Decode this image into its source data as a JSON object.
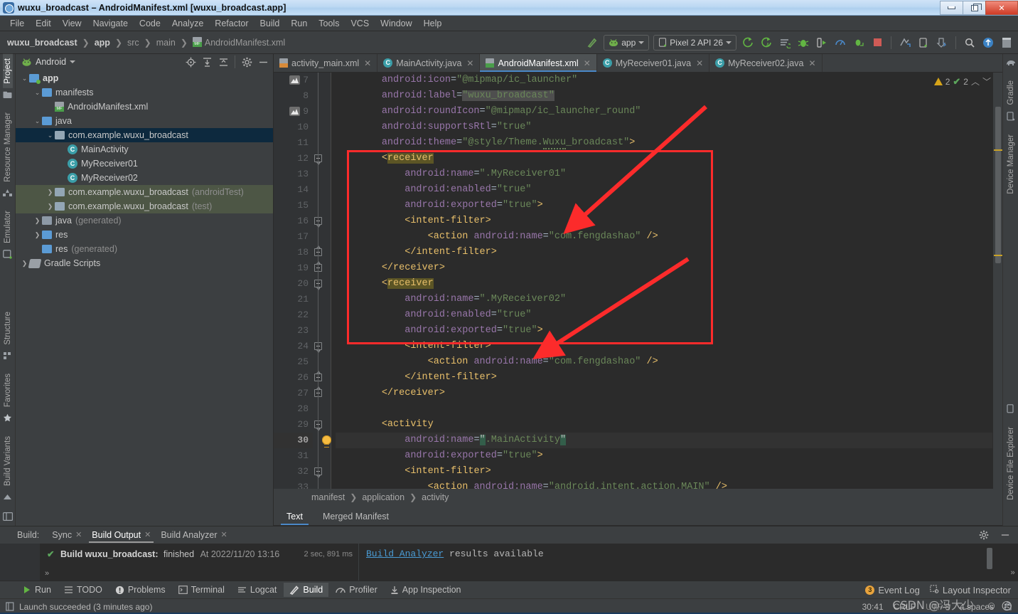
{
  "window": {
    "title": "wuxu_broadcast – AndroidManifest.xml [wuxu_broadcast.app]",
    "minimize_label": "Minimize",
    "maximize_label": "Restore",
    "close_label": "Close"
  },
  "menubar": [
    "File",
    "Edit",
    "View",
    "Navigate",
    "Code",
    "Analyze",
    "Refactor",
    "Build",
    "Run",
    "Tools",
    "VCS",
    "Window",
    "Help"
  ],
  "navbar": {
    "breadcrumbs": [
      {
        "label": "wuxu_broadcast",
        "bold": true,
        "icon": ""
      },
      {
        "label": "app",
        "bold": true,
        "icon": ""
      },
      {
        "label": "src",
        "bold": false,
        "icon": ""
      },
      {
        "label": "main",
        "bold": false,
        "icon": ""
      },
      {
        "label": "AndroidManifest.xml",
        "bold": false,
        "icon": "manifest-file-icon"
      }
    ],
    "run_config": "app",
    "device": "Pixel 2 API 26",
    "icons": [
      "build-hammer-icon",
      "run-icon",
      "rerun-icon",
      "apply-changes-icon",
      "debug-icon",
      "run-to-cursor-icon",
      "profiler-icon",
      "attach-debugger-icon",
      "stop-icon",
      "avd-manager-icon",
      "sdk-manager-icon",
      "sync-gradle-icon",
      "search-icon",
      "account-icon",
      "layout-icon"
    ]
  },
  "left_strip": [
    "Project",
    "Resource Manager",
    "Emulator",
    "Structure",
    "Favorites",
    "Build Variants"
  ],
  "right_strip": [
    "Gradle",
    "Device Manager",
    "Device File Explorer"
  ],
  "project_panel": {
    "title": "Android",
    "toolbar_icons": [
      "select-opened-file-icon",
      "expand-all-icon",
      "collapse-all-icon",
      "settings-gear-icon",
      "hide-icon"
    ],
    "tree": [
      {
        "depth": 0,
        "arrow": "v",
        "icon": "folder-app",
        "label": "app",
        "bold": true,
        "suffix": "",
        "state": "normal"
      },
      {
        "depth": 1,
        "arrow": "v",
        "icon": "folder",
        "label": "manifests",
        "bold": false,
        "suffix": "",
        "state": "normal"
      },
      {
        "depth": 2,
        "arrow": "",
        "icon": "manifest-file-icon",
        "label": "AndroidManifest.xml",
        "bold": false,
        "suffix": "",
        "state": "normal"
      },
      {
        "depth": 1,
        "arrow": "v",
        "icon": "folder",
        "label": "java",
        "bold": false,
        "suffix": "",
        "state": "normal"
      },
      {
        "depth": 2,
        "arrow": "v",
        "icon": "folder-pkg",
        "label": "com.example.wuxu_broadcast",
        "bold": false,
        "suffix": "",
        "state": "selected"
      },
      {
        "depth": 3,
        "arrow": "",
        "icon": "class-icon",
        "label": "MainActivity",
        "bold": false,
        "suffix": "",
        "state": "normal"
      },
      {
        "depth": 3,
        "arrow": "",
        "icon": "class-icon",
        "label": "MyReceiver01",
        "bold": false,
        "suffix": "",
        "state": "normal"
      },
      {
        "depth": 3,
        "arrow": "",
        "icon": "class-icon",
        "label": "MyReceiver02",
        "bold": false,
        "suffix": "",
        "state": "normal"
      },
      {
        "depth": 2,
        "arrow": ">",
        "icon": "folder-pkg",
        "label": "com.example.wuxu_broadcast",
        "bold": false,
        "suffix": "(androidTest)",
        "state": "test"
      },
      {
        "depth": 2,
        "arrow": ">",
        "icon": "folder-pkg",
        "label": "com.example.wuxu_broadcast",
        "bold": false,
        "suffix": "(test)",
        "state": "test"
      },
      {
        "depth": 1,
        "arrow": ">",
        "icon": "folder-gen",
        "label": "java",
        "bold": false,
        "suffix": "(generated)",
        "state": "normal"
      },
      {
        "depth": 1,
        "arrow": ">",
        "icon": "folder-res",
        "label": "res",
        "bold": false,
        "suffix": "",
        "state": "normal"
      },
      {
        "depth": 1,
        "arrow": "",
        "icon": "folder-res",
        "label": "res",
        "bold": false,
        "suffix": "(generated)",
        "state": "normal"
      },
      {
        "depth": 0,
        "arrow": ">",
        "icon": "gradle-icon",
        "label": "Gradle Scripts",
        "bold": false,
        "suffix": "",
        "state": "normal"
      }
    ]
  },
  "editor": {
    "tabs": [
      {
        "label": "activity_main.xml",
        "icon": "xml-layout-icon",
        "active": false
      },
      {
        "label": "MainActivity.java",
        "icon": "java-class-icon",
        "active": false
      },
      {
        "label": "AndroidManifest.xml",
        "icon": "manifest-file-icon",
        "active": true
      },
      {
        "label": "MyReceiver01.java",
        "icon": "java-class-icon",
        "active": false
      },
      {
        "label": "MyReceiver02.java",
        "icon": "java-class-icon",
        "active": false
      }
    ],
    "inspection": {
      "warnings": "2",
      "checks": "2"
    },
    "first_line": 7,
    "current_line": 30,
    "lines": [
      {
        "n": 7,
        "gutter_icon": "image-preview-icon",
        "fold": "",
        "html": "        <span class='attr'>android:icon</span><span class='eq'>=</span><span class='val'>\"@mipmap/ic_launcher\"</span>"
      },
      {
        "n": 8,
        "gutter_icon": "",
        "fold": "",
        "html": "        <span class='attr'>android:label</span><span class='eq'>=</span><span class='val hl'>\"wuxu_broadcast\"</span>"
      },
      {
        "n": 9,
        "gutter_icon": "image-preview-icon",
        "fold": "",
        "html": "        <span class='attr'>android:roundIcon</span><span class='eq'>=</span><span class='val'>\"@mipmap/ic_launcher_round\"</span>"
      },
      {
        "n": 10,
        "gutter_icon": "",
        "fold": "",
        "html": "        <span class='attr'>android:supportsRtl</span><span class='eq'>=</span><span class='val'>\"true\"</span>"
      },
      {
        "n": 11,
        "gutter_icon": "",
        "fold": "",
        "html": "        <span class='attr'>android:theme</span><span class='eq'>=</span><span class='val'>\"@style/Theme.<span class='wavy'>Wuxu</span>_broadcast\"</span><span class='tagp'>></span>"
      },
      {
        "n": 12,
        "gutter_icon": "",
        "fold": "down",
        "html": "        <span class='tagp'>&lt;</span><span class='tag hl'>receiver</span>"
      },
      {
        "n": 13,
        "gutter_icon": "",
        "fold": "",
        "html": "            <span class='attr'>android:name</span><span class='eq'>=</span><span class='val'>\".MyReceiver01\"</span>"
      },
      {
        "n": 14,
        "gutter_icon": "",
        "fold": "",
        "html": "            <span class='attr'>android:enabled</span><span class='eq'>=</span><span class='val'>\"true\"</span>"
      },
      {
        "n": 15,
        "gutter_icon": "",
        "fold": "",
        "html": "            <span class='attr'>android:exported</span><span class='eq'>=</span><span class='val'>\"true\"</span><span class='tagp'>></span>"
      },
      {
        "n": 16,
        "gutter_icon": "",
        "fold": "down",
        "html": "            <span class='tagp'>&lt;</span><span class='tag'>intent-filter</span><span class='tagp'>></span>"
      },
      {
        "n": 17,
        "gutter_icon": "",
        "fold": "",
        "html": "                <span class='tagp'>&lt;</span><span class='tag'>action</span> <span class='attr'>android:name</span><span class='eq'>=</span><span class='val'>\"com.fengdashao\"</span> <span class='tagp'>/></span>"
      },
      {
        "n": 18,
        "gutter_icon": "",
        "fold": "up",
        "html": "            <span class='tagp'>&lt;/</span><span class='tag'>intent-filter</span><span class='tagp'>></span>"
      },
      {
        "n": 19,
        "gutter_icon": "",
        "fold": "up",
        "html": "        <span class='tagp'>&lt;/</span><span class='tag'>receiver</span><span class='tagp'>></span>"
      },
      {
        "n": 20,
        "gutter_icon": "",
        "fold": "down",
        "html": "        <span class='tagp'>&lt;</span><span class='tag hl'>receiver</span>"
      },
      {
        "n": 21,
        "gutter_icon": "",
        "fold": "",
        "html": "            <span class='attr'>android:name</span><span class='eq'>=</span><span class='val'>\".MyReceiver02\"</span>"
      },
      {
        "n": 22,
        "gutter_icon": "",
        "fold": "",
        "html": "            <span class='attr'>android:enabled</span><span class='eq'>=</span><span class='val'>\"true\"</span>"
      },
      {
        "n": 23,
        "gutter_icon": "",
        "fold": "",
        "html": "            <span class='attr'>android:exported</span><span class='eq'>=</span><span class='val'>\"true\"</span><span class='tagp'>></span>"
      },
      {
        "n": 24,
        "gutter_icon": "",
        "fold": "down",
        "html": "            <span class='tagp'>&lt;</span><span class='tag'>intent-filter</span><span class='tagp'>></span>"
      },
      {
        "n": 25,
        "gutter_icon": "",
        "fold": "",
        "html": "                <span class='tagp'>&lt;</span><span class='tag'>action</span> <span class='attr'>android:name</span><span class='eq'>=</span><span class='val'>\"com.fengdashao\"</span> <span class='tagp'>/></span>"
      },
      {
        "n": 26,
        "gutter_icon": "",
        "fold": "up",
        "html": "            <span class='tagp'>&lt;/</span><span class='tag'>intent-filter</span><span class='tagp'>></span>"
      },
      {
        "n": 27,
        "gutter_icon": "",
        "fold": "up",
        "html": "        <span class='tagp'>&lt;/</span><span class='tag'>receiver</span><span class='tagp'>></span>"
      },
      {
        "n": 28,
        "gutter_icon": "",
        "fold": "",
        "html": ""
      },
      {
        "n": 29,
        "gutter_icon": "",
        "fold": "down",
        "html": "        <span class='tagp'>&lt;</span><span class='tag'>activity</span>"
      },
      {
        "n": 30,
        "gutter_icon": "intention-bulb-icon",
        "fold": "",
        "html": "            <span class='attr'>android:name</span><span class='eq'>=</span><span class='valsel'>\"</span><span class='val'>.MainActivity</span><span class='valsel'>\"</span>"
      },
      {
        "n": 31,
        "gutter_icon": "",
        "fold": "",
        "html": "            <span class='attr'>android:exported</span><span class='eq'>=</span><span class='val'>\"true\"</span><span class='tagp'>></span>"
      },
      {
        "n": 32,
        "gutter_icon": "",
        "fold": "down",
        "html": "            <span class='tagp'>&lt;</span><span class='tag'>intent-filter</span><span class='tagp'>></span>"
      },
      {
        "n": 33,
        "gutter_icon": "",
        "fold": "",
        "html": "                <span class='tagp'>&lt;</span><span class='tag'>action</span> <span class='attr'>android:name</span><span class='eq'>=</span><span class='val'>\"android.intent.action.MAIN\"</span> <span class='tagp'>/></span>"
      }
    ],
    "breadcrumbs": [
      "manifest",
      "application",
      "activity"
    ],
    "view_tabs": [
      {
        "label": "Text",
        "active": true
      },
      {
        "label": "Merged Manifest",
        "active": false
      }
    ]
  },
  "annotations": {
    "box_color": "#fc2b2b",
    "arrow_color": "#fc2b2b"
  },
  "build_window": {
    "label": "Build:",
    "tabs": [
      {
        "label": "Sync",
        "closable": true,
        "active": false
      },
      {
        "label": "Build Output",
        "closable": true,
        "active": true
      },
      {
        "label": "Build Analyzer",
        "closable": true,
        "active": false
      }
    ],
    "result_prefix": "Build wuxu_broadcast:",
    "result_status": "finished",
    "result_time": "At 2022/11/20 13:16",
    "duration": "2 sec, 891 ms",
    "analyzer_link": "Build Analyzer",
    "analyzer_text": " results available",
    "settings_icon": "settings-gear-icon",
    "hide_icon": "hide-icon"
  },
  "bottom_bar": {
    "items": [
      {
        "label": "Run",
        "icon": "run-icon",
        "active": false
      },
      {
        "label": "TODO",
        "icon": "todo-icon",
        "active": false
      },
      {
        "label": "Problems",
        "icon": "problems-icon",
        "active": false
      },
      {
        "label": "Terminal",
        "icon": "terminal-icon",
        "active": false
      },
      {
        "label": "Logcat",
        "icon": "logcat-icon",
        "active": false
      },
      {
        "label": "Build",
        "icon": "build-hammer-icon",
        "active": true
      },
      {
        "label": "Profiler",
        "icon": "profiler-icon",
        "active": false
      },
      {
        "label": "App Inspection",
        "icon": "app-inspection-icon",
        "active": false
      }
    ],
    "event_log": {
      "label": "Event Log",
      "count": "3"
    },
    "layout_inspector": {
      "label": "Layout Inspector",
      "icon": "layout-inspector-icon"
    }
  },
  "status_bar": {
    "message": "Launch succeeded (3 minutes ago)",
    "caret": "30:41",
    "line_separator": "CRLF",
    "encoding": "UTF-8",
    "indent": "4 spaces",
    "lock_icon": "lock-icon"
  },
  "watermark": "CSDN @冯大少"
}
